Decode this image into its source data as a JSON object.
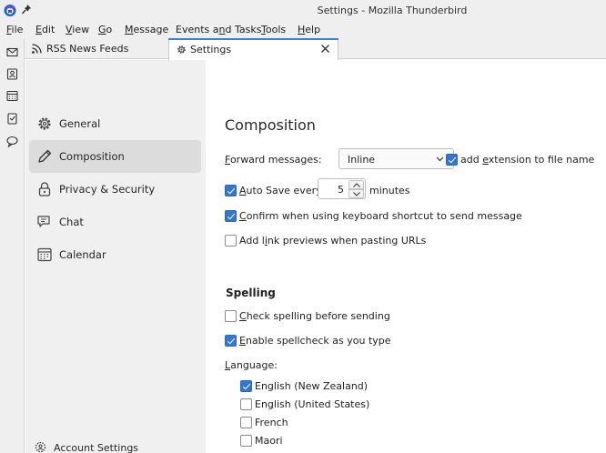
{
  "window": {
    "title": "Settings - Mozilla Thunderbird"
  },
  "menu": [
    {
      "pre": "",
      "acc": "F",
      "post": "ile"
    },
    {
      "pre": "",
      "acc": "E",
      "post": "dit"
    },
    {
      "pre": "",
      "acc": "V",
      "post": "iew"
    },
    {
      "pre": "",
      "acc": "G",
      "post": "o"
    },
    {
      "pre": "",
      "acc": "M",
      "post": "essage"
    },
    {
      "pre": "Events a",
      "acc": "n",
      "post": "d Tasks"
    },
    {
      "pre": "",
      "acc": "T",
      "post": "ools"
    },
    {
      "pre": "",
      "acc": "H",
      "post": "elp"
    }
  ],
  "spaces": [
    "mail-icon",
    "address-book-icon",
    "calendar-icon",
    "tasks-icon",
    "chat-icon"
  ],
  "tabs": [
    {
      "label": "RSS News Feeds",
      "icon": "rss-icon",
      "selected": false
    },
    {
      "label": "Settings",
      "icon": "gear-icon",
      "selected": true
    }
  ],
  "sidebar": {
    "items": [
      {
        "label": "General",
        "icon": "gear-icon",
        "selected": false
      },
      {
        "label": "Composition",
        "icon": "pencil-icon",
        "selected": true
      },
      {
        "label": "Privacy & Security",
        "icon": "lock-icon",
        "selected": false
      },
      {
        "label": "Chat",
        "icon": "chat-icon",
        "selected": false
      },
      {
        "label": "Calendar",
        "icon": "calendar-icon",
        "selected": false
      }
    ],
    "account_settings": "Account Settings"
  },
  "composition": {
    "title": "Composition",
    "forward": {
      "label_acc": "F",
      "label_rest": "orward messages:",
      "value": "Inline",
      "ext_pre": "add ",
      "ext_acc": "e",
      "ext_post": "xtension to file name",
      "ext_checked": true
    },
    "autosave": {
      "checked": true,
      "label_pre": "",
      "label_acc": "A",
      "label_post": "uto Save every",
      "value": "5",
      "unit": "minutes"
    },
    "confirm": {
      "checked": true,
      "label_pre": "",
      "label_acc": "C",
      "label_post": "onfirm when using keyboard shortcut to send message"
    },
    "link_previews": {
      "checked": false,
      "label_pre": "Add l",
      "label_acc": "i",
      "label_post": "nk previews when pasting URLs"
    }
  },
  "spelling": {
    "title": "Spelling",
    "check_before_send": {
      "checked": false,
      "label_pre": "",
      "label_acc": "C",
      "label_post": "heck spelling before sending"
    },
    "spellcheck_as_type": {
      "checked": true,
      "label_pre": "",
      "label_acc": "E",
      "label_post": "nable spellcheck as you type"
    },
    "language_label_acc": "L",
    "language_label_rest": "anguage:",
    "languages": [
      {
        "label": "English (New Zealand)",
        "checked": true
      },
      {
        "label": "English (United States)",
        "checked": false
      },
      {
        "label": "French",
        "checked": false
      },
      {
        "label": "Maori",
        "checked": false
      }
    ]
  },
  "colors": {
    "accent": "#3477d0",
    "sidebar_bg": "#f0f0f0",
    "chrome_bg": "#efefef"
  }
}
